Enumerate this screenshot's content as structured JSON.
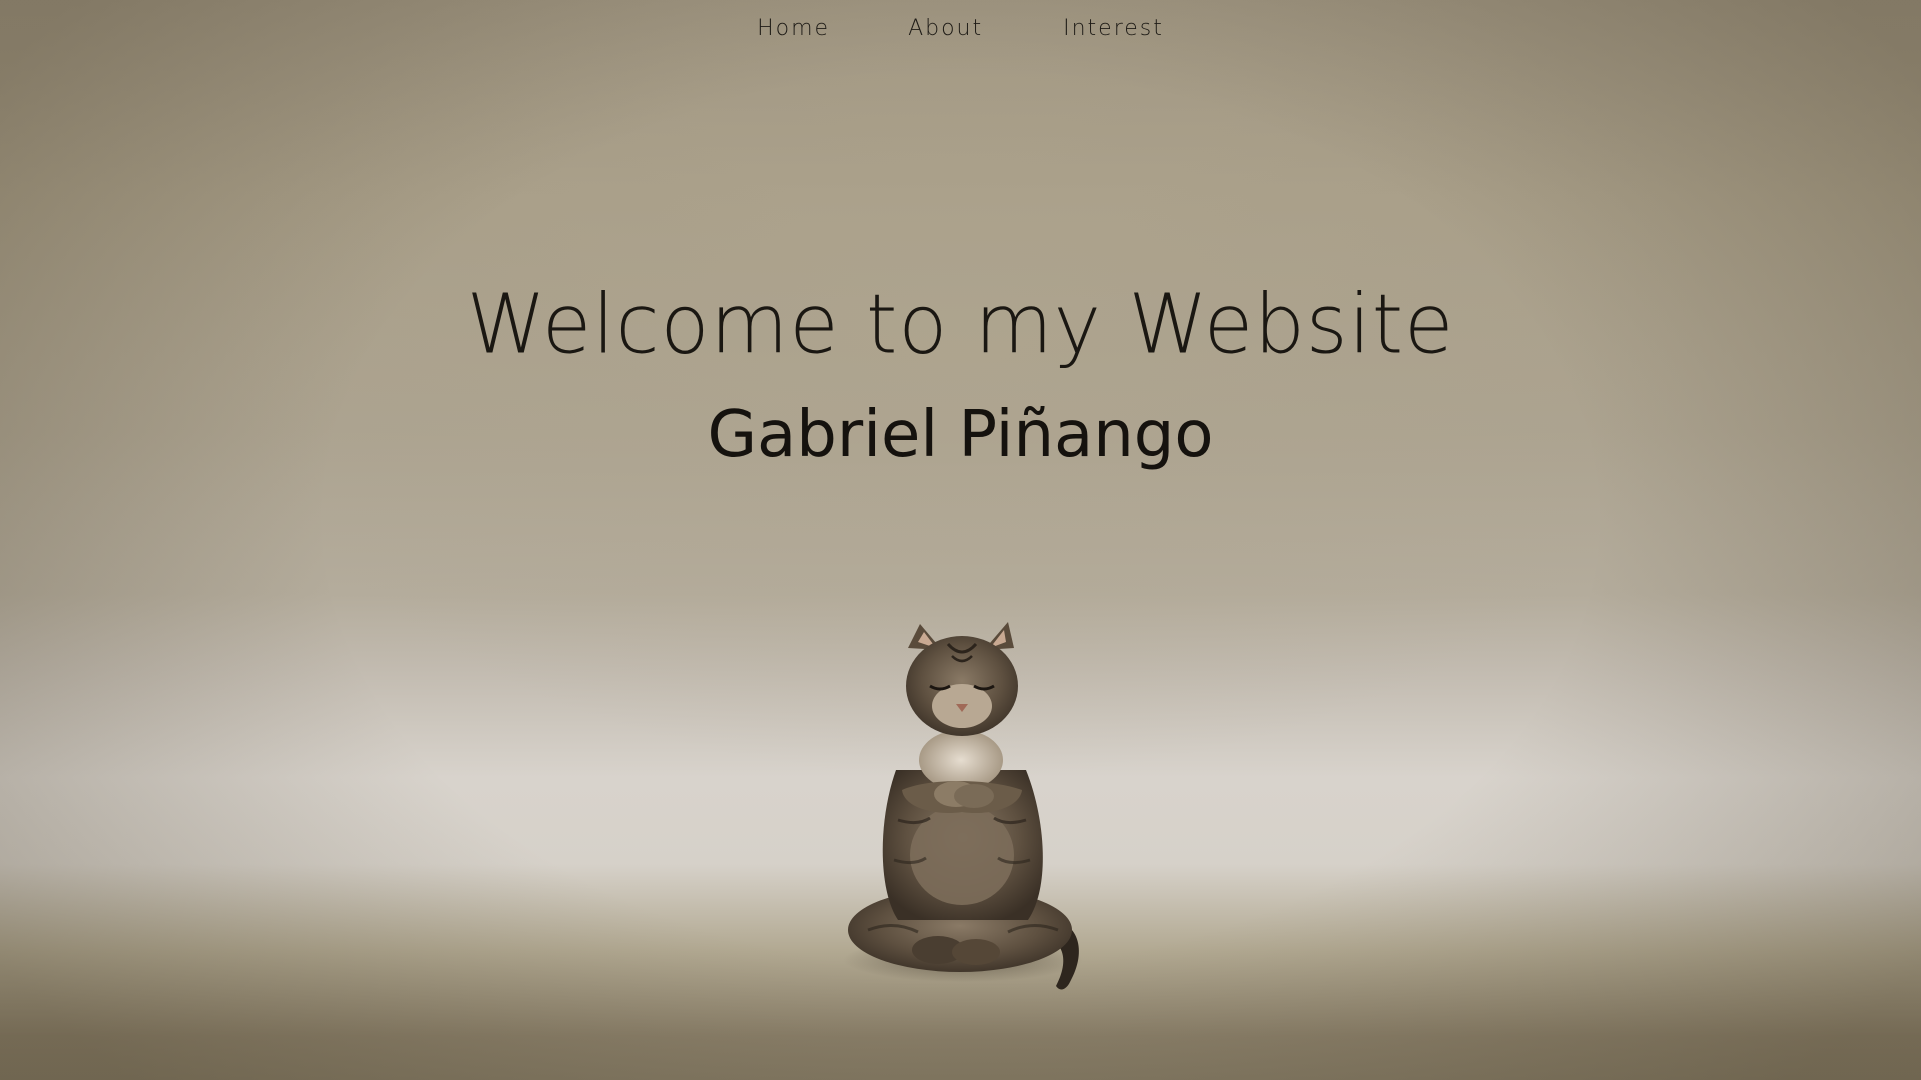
{
  "nav": {
    "items": [
      {
        "label": "Home"
      },
      {
        "label": "About"
      },
      {
        "label": "Interest"
      }
    ]
  },
  "hero": {
    "title": "Welcome to my Website",
    "name": "Gabriel Piñango"
  },
  "image": {
    "subject": "meditating-cat"
  },
  "colors": {
    "background_top": "#a89e88",
    "background_floor": "#d8d3cc",
    "text": "#1a1712"
  }
}
